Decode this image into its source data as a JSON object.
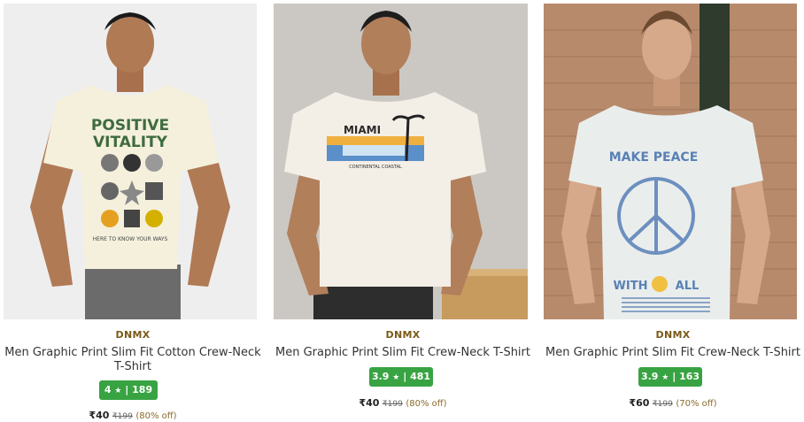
{
  "products": [
    {
      "brand": "DNMX",
      "name": "Men Graphic Print Slim Fit Cotton Crew-Neck T-Shirt",
      "rating": "4",
      "star": "★",
      "rating_sep": "|",
      "rating_count": "189",
      "price": "₹40",
      "mrp": "₹199",
      "discount": "(80% off)",
      "print": {
        "line1": "POSITIVE",
        "line2": "VITALITY",
        "caption": "HERE TO KNOW YOUR WAYS"
      }
    },
    {
      "brand": "DNMX",
      "name": "Men Graphic Print Slim Fit Crew-Neck T-Shirt",
      "rating": "3.9",
      "star": "★",
      "rating_sep": "|",
      "rating_count": "481",
      "price": "₹40",
      "mrp": "₹199",
      "discount": "(80% off)",
      "print": {
        "line1": "MIAMI",
        "caption": "CONTINENTAL COASTAL"
      }
    },
    {
      "brand": "DNMX",
      "name": "Men Graphic Print Slim Fit Crew-Neck T-Shirt",
      "rating": "3.9",
      "star": "★",
      "rating_sep": "|",
      "rating_count": "163",
      "price": "₹60",
      "mrp": "₹199",
      "discount": "(70% off)",
      "print": {
        "line1": "MAKE PEACE",
        "line2": "WITH",
        "line3": "ALL"
      }
    }
  ],
  "colors": {
    "rating_badge": "#38a342",
    "brand": "#7a5a18",
    "discount": "#8a6a2c"
  }
}
